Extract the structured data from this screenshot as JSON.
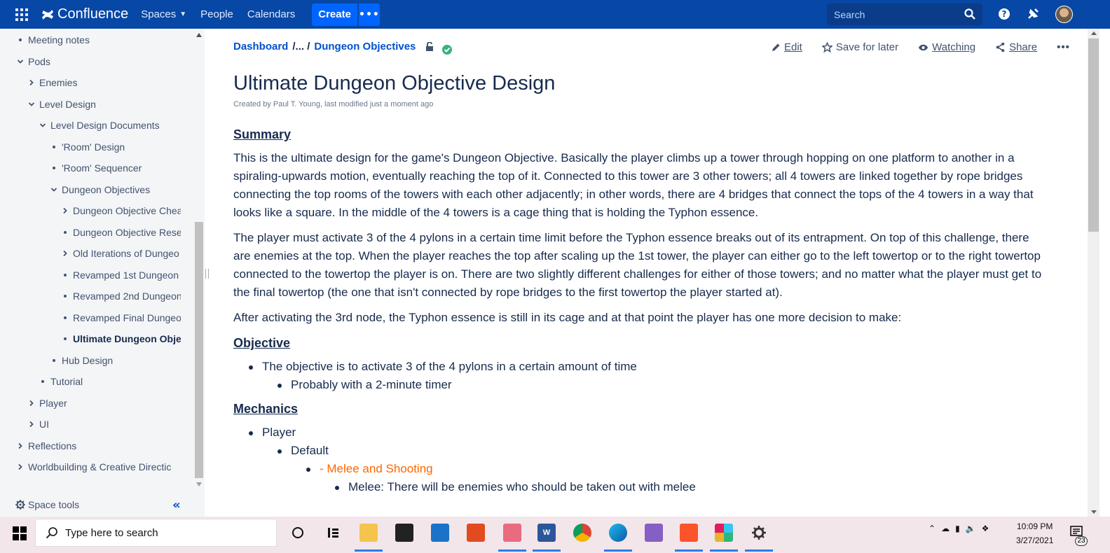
{
  "topnav": {
    "logo_text": "Confluence",
    "spaces_label": "Spaces",
    "people_label": "People",
    "calendars_label": "Calendars",
    "create_label": "Create",
    "more_label": "•••",
    "search_placeholder": "Search",
    "help_label": "?"
  },
  "sidebar": {
    "items": [
      {
        "label": "Meeting notes",
        "marker": "dot"
      },
      {
        "label": "Pods",
        "marker": "open"
      },
      {
        "label": "Enemies",
        "marker": "closed"
      },
      {
        "label": "Level Design",
        "marker": "open"
      },
      {
        "label": "Level Design Documents",
        "marker": "open"
      },
      {
        "label": "'Room' Design",
        "marker": "dot"
      },
      {
        "label": "'Room' Sequencer",
        "marker": "dot"
      },
      {
        "label": "Dungeon Objectives",
        "marker": "open"
      },
      {
        "label": "Dungeon Objective Chea",
        "marker": "closed"
      },
      {
        "label": "Dungeon Objective Rese",
        "marker": "dot"
      },
      {
        "label": "Old Iterations of Dungeo",
        "marker": "closed"
      },
      {
        "label": "Revamped 1st Dungeon",
        "marker": "dot"
      },
      {
        "label": "Revamped 2nd Dungeon",
        "marker": "dot"
      },
      {
        "label": "Revamped Final Dungeo",
        "marker": "dot"
      },
      {
        "label": "Ultimate Dungeon Obje",
        "marker": "dot",
        "active": true
      },
      {
        "label": "Hub Design",
        "marker": "dot"
      },
      {
        "label": "Tutorial",
        "marker": "dot"
      },
      {
        "label": "Player",
        "marker": "closed"
      },
      {
        "label": "UI",
        "marker": "closed"
      },
      {
        "label": "Reflections",
        "marker": "closed"
      },
      {
        "label": "Worldbuilding & Creative Directic",
        "marker": "closed"
      }
    ],
    "space_tools_label": "Space tools",
    "collapse_label": "«"
  },
  "breadcrumb": {
    "root": "Dashboard",
    "ellipsis": "/... /",
    "parent": "Dungeon Objectives"
  },
  "actions": {
    "edit": "Edit",
    "save_for_later": "Save for later",
    "watching": "Watching",
    "share": "Share",
    "more": "•••"
  },
  "page": {
    "title": "Ultimate Dungeon Objective Design",
    "byline": "Created by Paul T. Young, last modified just a moment ago",
    "summary_heading": "Summary",
    "summary_p1": "This is the ultimate design for the game's Dungeon Objective. Basically the player climbs up a tower through hopping on one platform to another in a spiraling-upwards motion, eventually reaching the top of it. Connected to this tower are 3 other towers; all 4 towers are linked together by rope bridges connecting the top rooms of the towers with each other adjacently; in other words, there are 4 bridges that connect the tops of the 4 towers in a way that looks like a square. In the middle of the 4 towers is a cage thing that is holding the Typhon essence.",
    "summary_p2": "The player must activate 3 of the 4 pylons in a certain time limit before the Typhon essence breaks out of its entrapment. On top of this challenge, there are enemies at the top. When the player reaches the top after scaling up the 1st tower, the player can either go to the left towertop or to the right towertop connected to the towertop the player is on. There are two slightly different challenges for either of those towers; and no matter what the player must get to the final towertop (the one that isn't connected by rope bridges to the first towertop the player started at).",
    "summary_p3": "After activating the 3rd node, the Typhon essence is still in its cage and at that point the player has one more decision to make:",
    "objective_heading": "Objective",
    "objective_item": "The objective is to activate 3 of the 4 pylons in a certain amount of time",
    "objective_sub": "Probably with a 2-minute timer",
    "mechanics_heading": "Mechanics",
    "mech_player": "Player",
    "mech_default": "Default",
    "mech_melee_shooting": "- Melee and Shooting",
    "mech_melee": "Melee: There will be enemies who should be taken out with melee",
    "accent_orange": "#ff6600"
  },
  "taskbar": {
    "search_placeholder": "Type here to search",
    "time": "10:09 PM",
    "date": "3/27/2021",
    "notification_count": "23",
    "apps": [
      "cortana-icon",
      "task-view-icon",
      "file-explorer-icon",
      "store-icon",
      "mail-icon",
      "office-icon",
      "snip-icon",
      "word-icon",
      "chrome-icon",
      "edge-icon",
      "visual-studio-icon",
      "brave-icon",
      "slack-icon",
      "settings-icon"
    ]
  }
}
